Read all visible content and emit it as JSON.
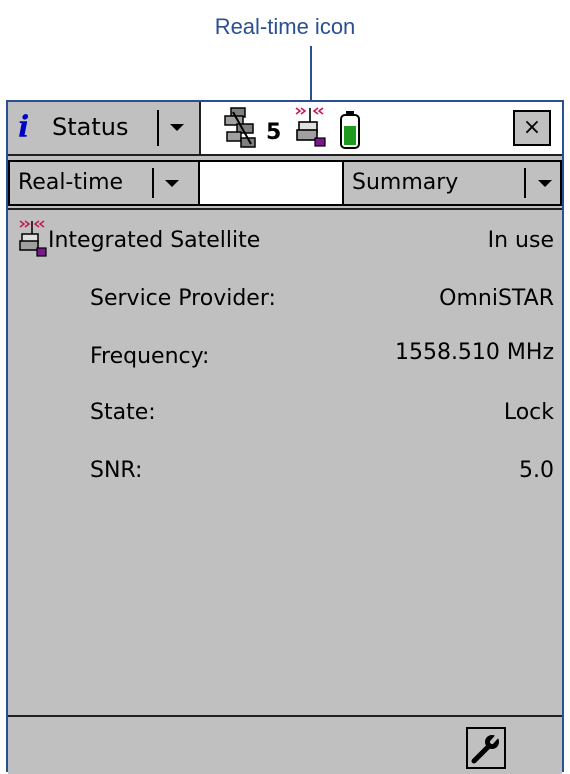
{
  "callout": {
    "label": "Real-time icon"
  },
  "titlebar": {
    "status_label": "Status",
    "satellite_count": "5",
    "close_label": "×",
    "icons": [
      "help-icon",
      "satellite-icon",
      "real-time-icon",
      "battery-icon",
      "close-icon"
    ]
  },
  "toolbar": {
    "left_select": "Real-time",
    "right_select": "Summary"
  },
  "content": {
    "header": {
      "label": "Integrated Satellite",
      "value": "In use"
    },
    "rows": [
      {
        "label": "Service Provider:",
        "value": "OmniSTAR"
      },
      {
        "label": "Frequency:",
        "value": "1558.510 MHz"
      },
      {
        "label": "State:",
        "value": "Lock"
      },
      {
        "label": "SNR:",
        "value": "5.0"
      }
    ]
  },
  "bottombar": {
    "icons": [
      "wrench-icon"
    ]
  },
  "colors": {
    "accent": "#2a4f93",
    "panel": "#c0c0c0",
    "help": "#0000c8",
    "battery": "#1f9a1f"
  }
}
